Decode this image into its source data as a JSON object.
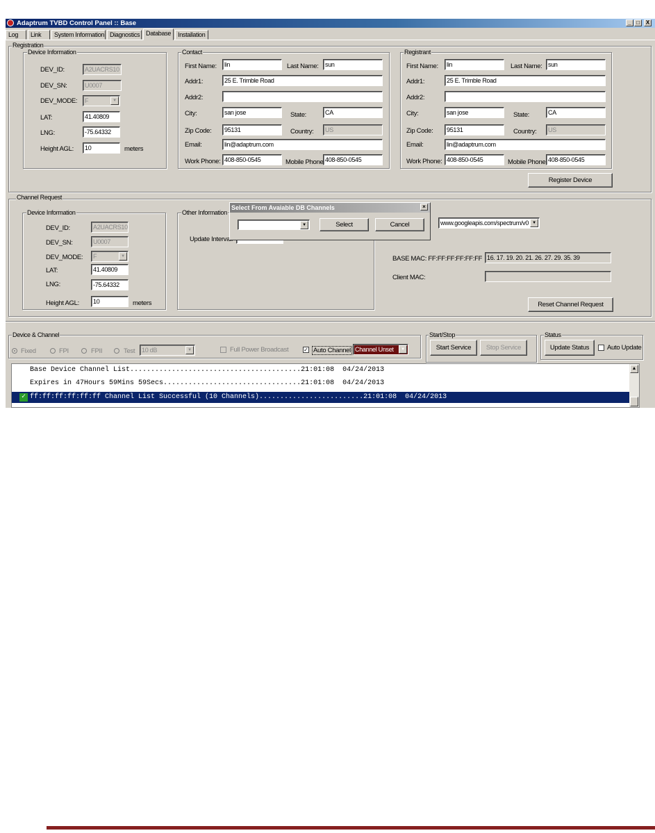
{
  "window": {
    "title": "Adaptrum TVBD Control Panel :: Base",
    "buttons": [
      "_",
      "□",
      "X"
    ]
  },
  "tabs": [
    "Log",
    "Link",
    "System Information",
    "Diagnostics",
    "Database",
    "Installation"
  ],
  "registration": {
    "legend": "Registration",
    "device": {
      "legend": "Device Information",
      "fields": [
        {
          "label": "DEV_ID:",
          "value": "A2UACRS10"
        },
        {
          "label": "DEV_SN:",
          "value": "U0007"
        },
        {
          "label": "DEV_MODE:",
          "value": "F"
        },
        {
          "label": "LAT:",
          "value": "41.40809"
        },
        {
          "label": "LNG:",
          "value": "-75.64332"
        },
        {
          "label": "Height AGL:",
          "value": "10",
          "unit": "meters"
        }
      ]
    },
    "contact": {
      "legend": "Contact",
      "first_label": "First Name:",
      "first": "lin",
      "last_label": "Last Name:",
      "last": "sun",
      "addr1_label": "Addr1:",
      "addr1": "25 E. Trimble Road",
      "addr2_label": "Addr2:",
      "addr2": "",
      "city_label": "City:",
      "city": "san jose",
      "state_label": "State:",
      "state": "CA",
      "zip_label": "Zip Code:",
      "zip": "95131",
      "country_label": "Country:",
      "country": "US",
      "email_label": "Email:",
      "email": "lin@adaptrum.com",
      "work_label": "Work Phone:",
      "work": "408-850-0545",
      "mobile_label": "Mobile Phone:",
      "mobile": "408-850-0545"
    },
    "registrant": {
      "legend": "Registrant",
      "first_label": "First Name:",
      "first": "lin",
      "last_label": "Last Name:",
      "last": "sun",
      "addr1_label": "Addr1:",
      "addr1": "25 E. Trimble Road",
      "addr2_label": "Addr2:",
      "addr2": "",
      "city_label": "City:",
      "city": "san jose",
      "state_label": "State:",
      "state": "CA",
      "zip_label": "Zip Code:",
      "zip": "95131",
      "country_label": "Country:",
      "country": "US",
      "email_label": "Email:",
      "email": "lin@adaptrum.com",
      "work_label": "Work Phone:",
      "work": "408-850-0545",
      "mobile_label": "Mobile Phone:",
      "mobile": "408-850-0545"
    },
    "register_button": "Register Device"
  },
  "channel_request": {
    "legend": "Channel Request",
    "device": {
      "legend": "Device Information",
      "fields": [
        {
          "label": "DEV_ID:",
          "value": "A2UACRS10"
        },
        {
          "label": "DEV_SN:",
          "value": "U0007"
        },
        {
          "label": "DEV_MODE:",
          "value": "F"
        },
        {
          "label": "LAT:",
          "value": "41.40809"
        },
        {
          "label": "LNG:",
          "value": "-75.64332"
        },
        {
          "label": "Height AGL:",
          "value": "10",
          "unit": "meters"
        }
      ]
    },
    "other_legend": "Other Information",
    "update_interval_label": "Update Interval:",
    "url": "www.googleapis.com/spectrum/v0",
    "base_mac_label": "BASE MAC: FF:FF:FF:FF:FF:FF",
    "base_mac_value": "16. 17. 19. 20. 21. 26. 27. 29. 35. 39",
    "client_mac_label": "Client MAC:",
    "client_mac_value": "",
    "reset_button": "Reset Channel Request"
  },
  "dialog": {
    "title": "Select From Avaiable DB Channels",
    "select_value": "",
    "select_button": "Select",
    "cancel_button": "Cancel"
  },
  "device_channel": {
    "legend": "Device & Channel",
    "radios": [
      "Fixed",
      "FPI",
      "FPII",
      "Test"
    ],
    "test_select": "10 dB",
    "full_power": "Full Power Broadcast",
    "auto_channel": "Auto Channel",
    "channel_select": "Channel Unset"
  },
  "start_stop": {
    "legend": "Start/Stop",
    "start": "Start Service",
    "stop": "Stop Service"
  },
  "status": {
    "legend": "Status",
    "update": "Update Status",
    "auto": "Auto Update"
  },
  "log": [
    {
      "text": "Base Device Channel List.........................................21:01:08  04/24/2013"
    },
    {
      "text": "Expires in 47Hours 59Mins 59Secs.................................21:01:08  04/24/2013"
    },
    {
      "text": "ff:ff:ff:ff:ff:ff Channel List Successful (10 Channels).........................21:01:08  04/24/2013"
    }
  ]
}
